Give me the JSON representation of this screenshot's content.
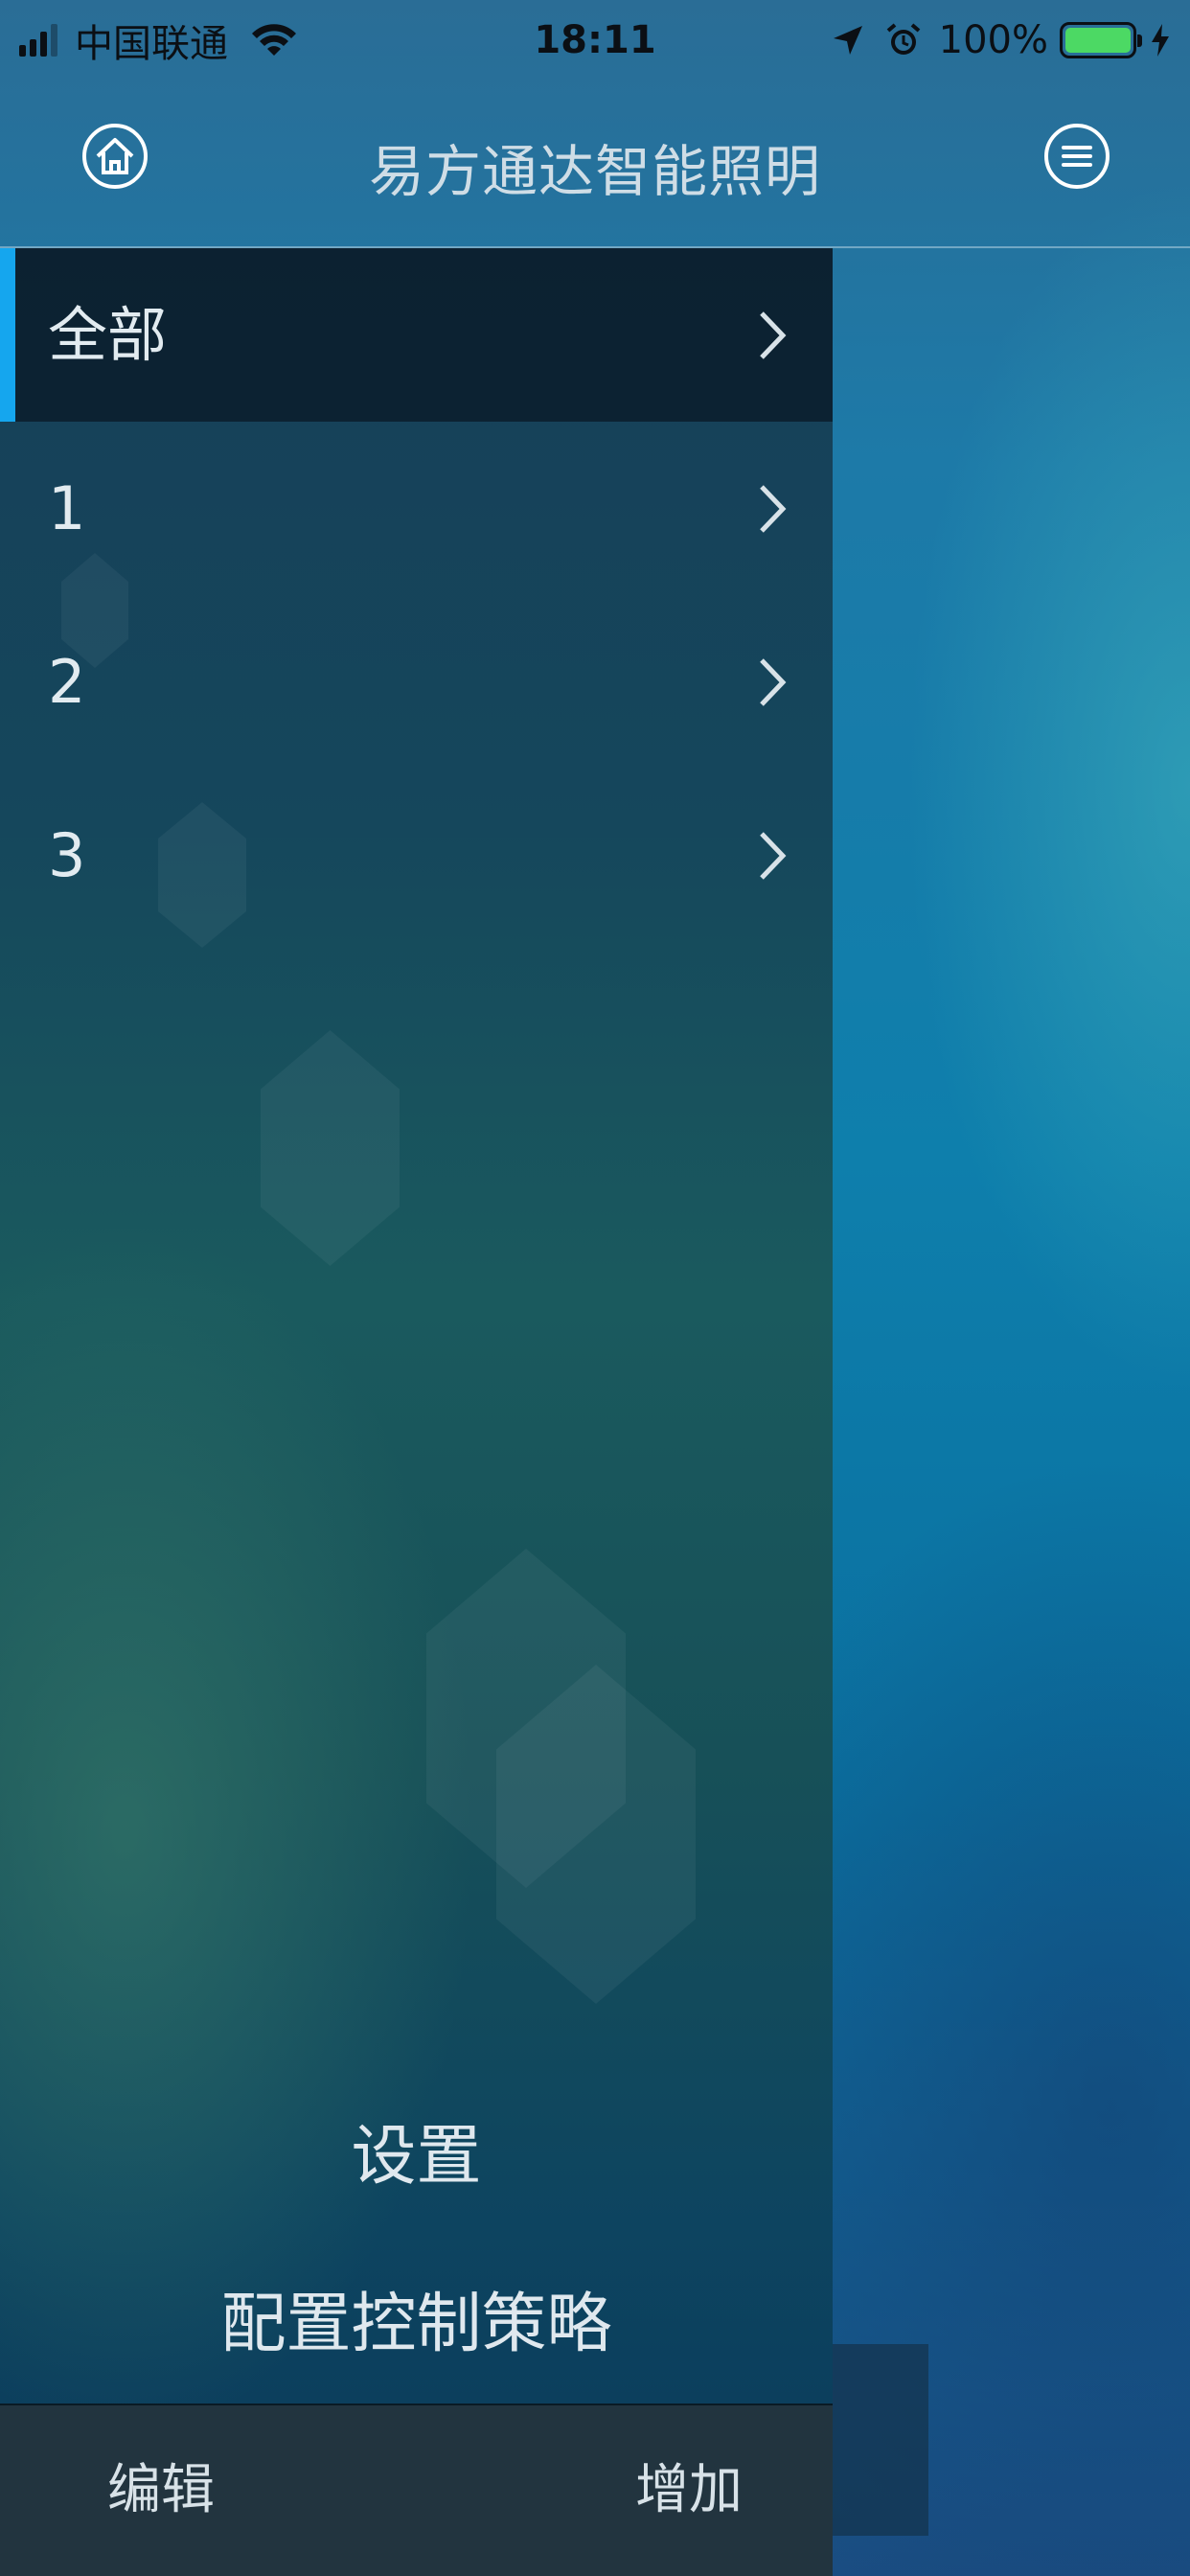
{
  "status_bar": {
    "carrier": "中国联通",
    "time": "18:11",
    "battery_percent": "100%",
    "battery_color": "#4cd964"
  },
  "nav": {
    "title": "易方通达智能照明",
    "home_icon": "home-icon",
    "menu_icon": "menu-icon"
  },
  "drawer": {
    "items": [
      {
        "label": "全部",
        "active": true
      },
      {
        "label": "1",
        "active": false
      },
      {
        "label": "2",
        "active": false
      },
      {
        "label": "3",
        "active": false
      }
    ],
    "settings_label": "设置",
    "strategy_label": "配置控制策略",
    "accent_color": "#15a6ee"
  },
  "bottom_bar": {
    "edit_label": "编辑",
    "add_label": "增加"
  }
}
